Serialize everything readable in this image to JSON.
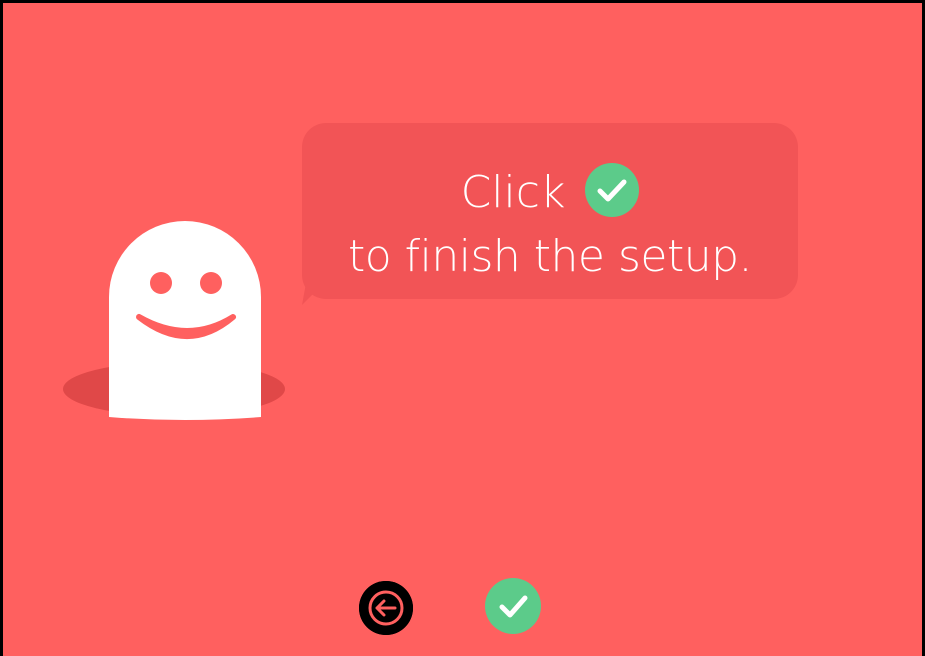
{
  "theme": {
    "background": "#FF605F",
    "bubble_color": "#F25456",
    "check_color": "#5CCB8A",
    "ghost_color": "#FFFFFF",
    "hole_color": "#E04848"
  },
  "bubble": {
    "line1_prefix": "Click",
    "line1_icon": "check-circle-icon",
    "line2": "to finish the setup."
  },
  "navigation": {
    "back_icon": "arrow-left-icon",
    "finish_icon": "check-circle-icon"
  }
}
